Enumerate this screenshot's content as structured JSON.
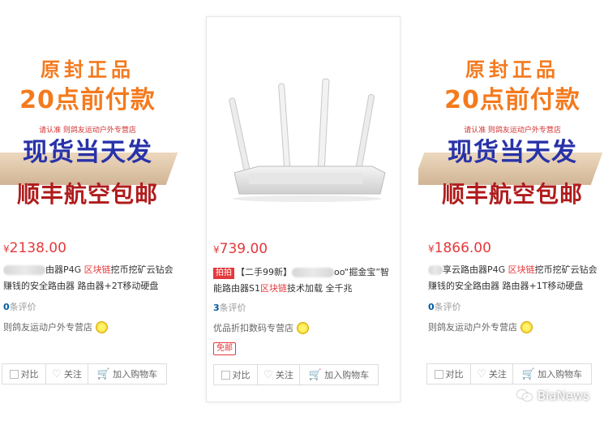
{
  "products": [
    {
      "promo": [
        "原封正品",
        "20点前付款",
        "请认准 则鸽友运动户外专营店",
        "现货当天发",
        "顺丰航空包邮"
      ],
      "price": "2138.00",
      "title_pre": "由器P4G ",
      "title_hl": "区块链",
      "title_post": "挖币挖矿云钻会赚钱的安全路由器 路由器+2T移动硬盘",
      "review_count": "0",
      "review_label": "条评价",
      "shop": "则鸽友运动户外专营店",
      "actions": {
        "compare": "对比",
        "follow": "关注",
        "cart": "加入购物车"
      }
    },
    {
      "tag": "拍拍",
      "price": "739.00",
      "title_pre": "【二手99新】",
      "title_mid": "oo“掘金宝”智能路由器S1",
      "title_hl": "区块链",
      "title_post": "技术加载 全千兆",
      "review_count": "3",
      "review_label": "条评价",
      "shop": "优品折扣数码专营店",
      "free_ship": "免邮",
      "actions": {
        "compare": "对比",
        "follow": "关注",
        "cart": "加入购物车"
      }
    },
    {
      "promo": [
        "原封正品",
        "20点前付款",
        "请认准 则鸽友运动户外专营店",
        "现货当天发",
        "顺丰航空包邮"
      ],
      "price": "1866.00",
      "title_pre": "享云路由器P4G ",
      "title_hl": "区块链",
      "title_post": "挖币挖矿云钻会赚钱的安全路由器 路由器+1T移动硬盘",
      "review_count": "0",
      "review_label": "条评价",
      "shop": "则鸽友运动户外专营店",
      "actions": {
        "compare": "对比",
        "follow": "关注",
        "cart": "加入购物车"
      }
    }
  ],
  "currency": "¥",
  "watermark": "BiaNews",
  "colors": {
    "price": "#e4393c",
    "promo_orange": "#f47a1e",
    "promo_blue": "#2832a8",
    "promo_red": "#b01c1c"
  }
}
